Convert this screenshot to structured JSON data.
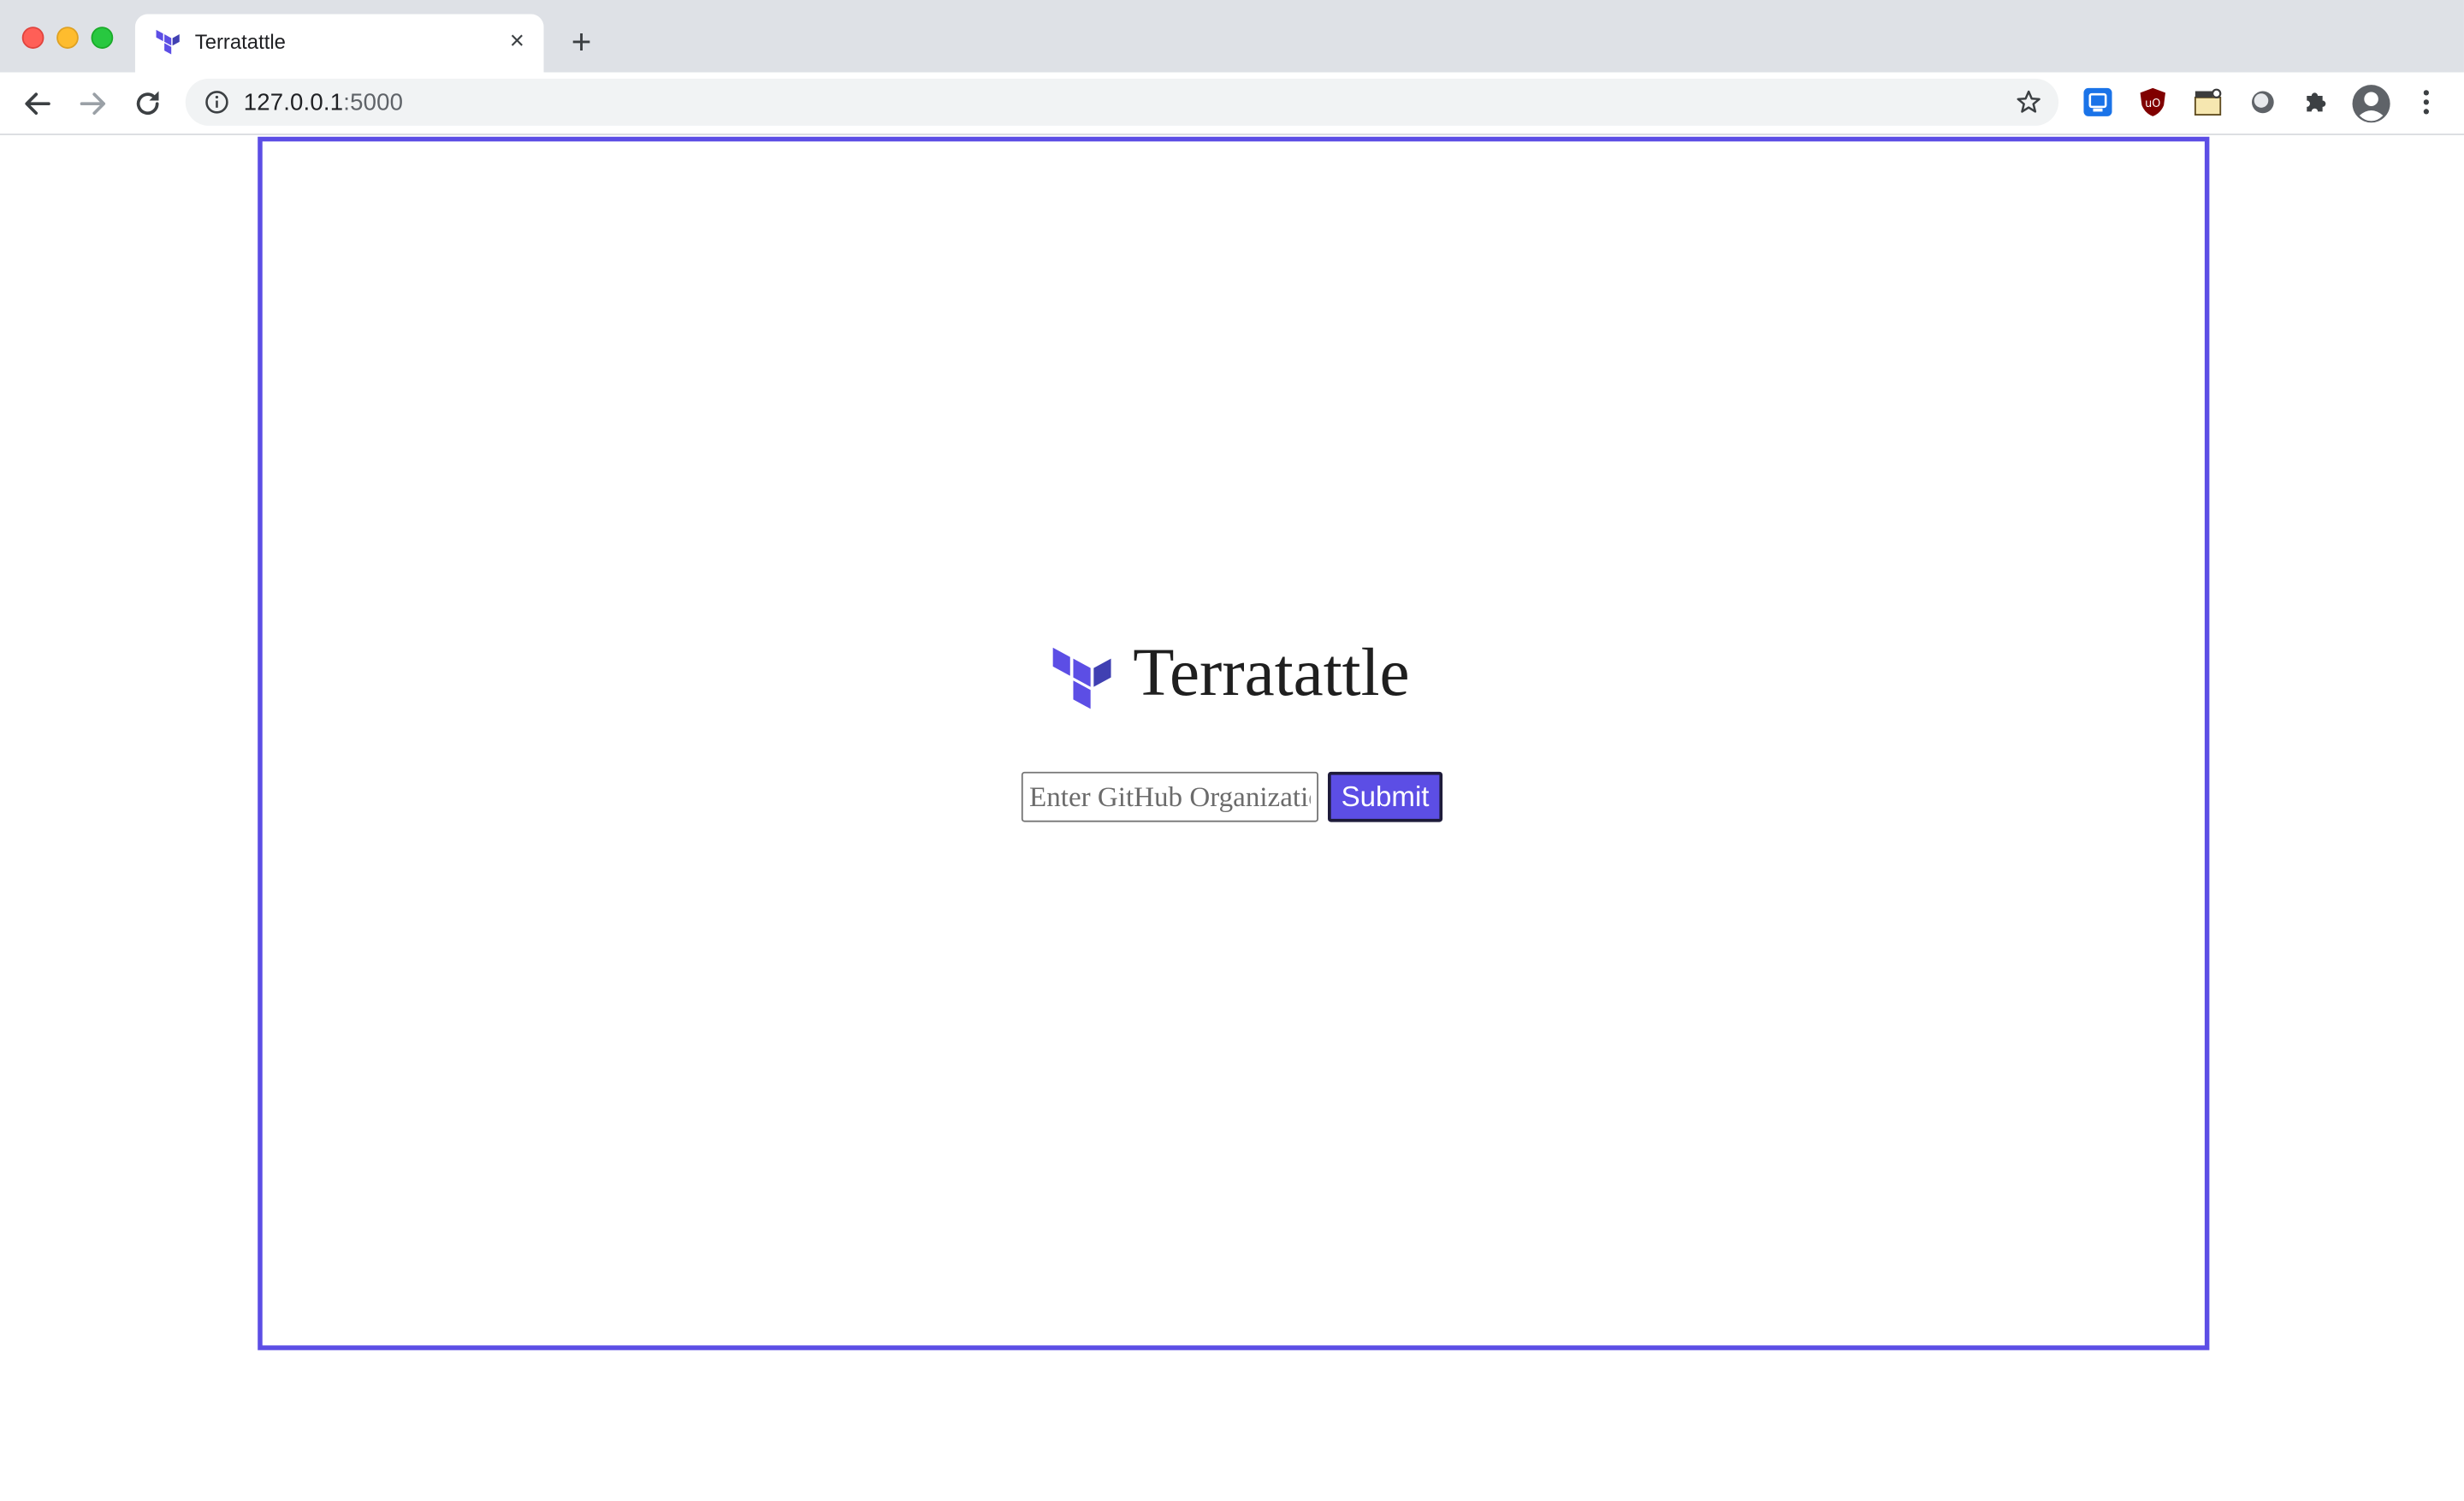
{
  "browser": {
    "tab": {
      "title": "Terratattle",
      "favicon": "terraform-logo-icon"
    },
    "new_tab_label": "+",
    "close_tab_label": "×",
    "address_bar": {
      "host": "127.0.0.1",
      "port": ":5000"
    },
    "extensions": [
      "extension-blue-icon",
      "ublock-shield-icon",
      "clapperboard-icon",
      "circle-extension-icon",
      "puzzle-piece-icon"
    ]
  },
  "page": {
    "brand": {
      "name": "Terratattle",
      "logo": "terraform-logo-icon"
    },
    "form": {
      "input_placeholder": "Enter GitHub Organization",
      "input_value": "",
      "submit_label": "Submit"
    },
    "colors": {
      "accent": "#5c4ee5",
      "frame_border": "#5c4ee5"
    }
  }
}
